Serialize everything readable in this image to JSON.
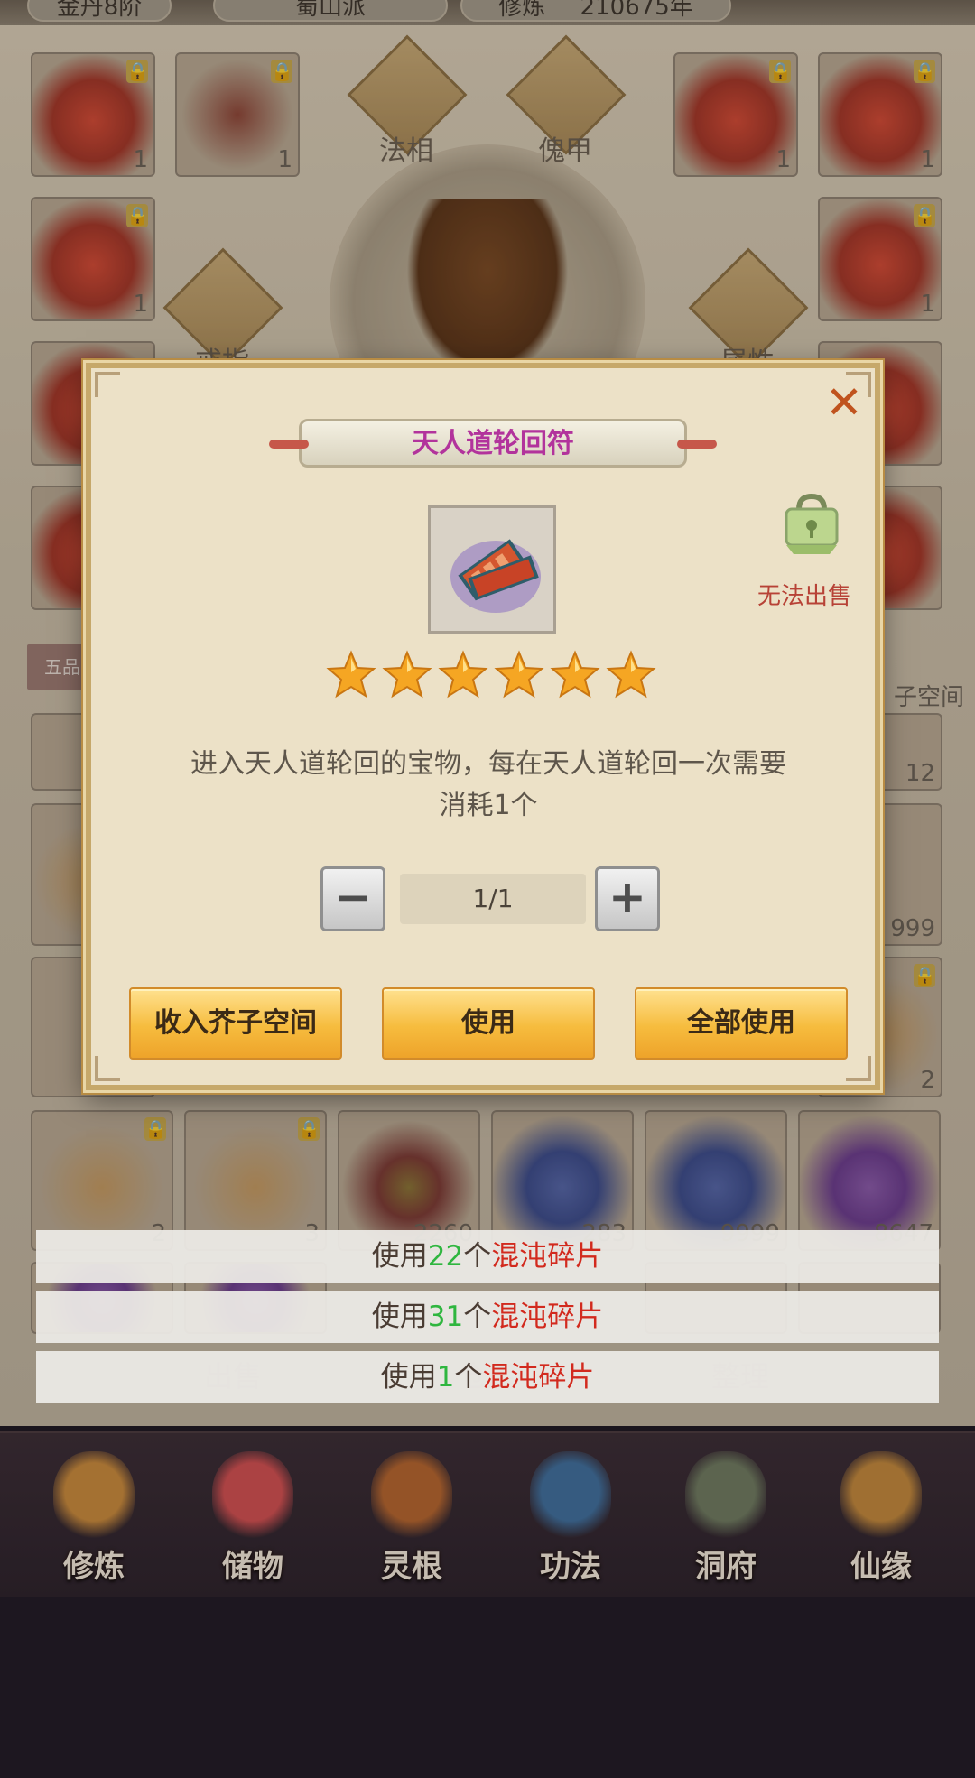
{
  "topbar": {
    "realm_label": "金丹8阶",
    "sect_label": "蜀山派",
    "cultivation_label": "修炼",
    "cultivation_value": "210675年"
  },
  "equipment": {
    "slots_top_left": [
      {
        "count": "1",
        "icon": "fire-armor-icon",
        "locked": true
      },
      {
        "count": "1",
        "icon": "bow-icon",
        "locked": true
      },
      {
        "count": "1",
        "icon": "fire-armor-icon",
        "locked": true
      },
      {
        "count": "1",
        "icon": "fire-armor-icon",
        "locked": true
      },
      {
        "count": "1",
        "icon": "fire-armor-icon",
        "locked": true
      }
    ],
    "faxiang_label": "法相",
    "kuijia_label": "傀甲",
    "ring_label": "戒指",
    "attr_label": "属性",
    "rank_tab": "五品",
    "space_label": "子空间"
  },
  "inventory": {
    "row_counts": [
      "12",
      "999",
      "2"
    ],
    "bottom_row": [
      {
        "count": "2",
        "icon": "scroll-icon",
        "locked": true
      },
      {
        "count": "3",
        "icon": "scroll-icon",
        "locked": true
      },
      {
        "count": "2260",
        "icon": "grape-fruit-icon",
        "locked": false
      },
      {
        "count": "283",
        "icon": "blue-lotus-icon",
        "locked": false
      },
      {
        "count": "9999",
        "icon": "blue-lotus-icon",
        "locked": false
      },
      {
        "count": "8647",
        "icon": "purple-lotus-icon",
        "locked": false
      }
    ]
  },
  "bottom_actions": {
    "sell": "出售",
    "middle": "仓库",
    "organize": "整理"
  },
  "nav": [
    {
      "label": "修炼",
      "icon": "hooded-monk-icon",
      "color": "#c98a3a"
    },
    {
      "label": "储物",
      "icon": "treasure-bag-icon",
      "color": "#d14f4f"
    },
    {
      "label": "灵根",
      "icon": "spirit-root-icon",
      "color": "#b5652c"
    },
    {
      "label": "功法",
      "icon": "technique-book-icon",
      "color": "#3f6f9c"
    },
    {
      "label": "洞府",
      "icon": "cave-gate-icon",
      "color": "#6e7a5e"
    },
    {
      "label": "仙缘",
      "icon": "gourd-icon",
      "color": "#c2883a"
    }
  ],
  "dialog": {
    "title": "天人道轮回符",
    "item_icon": "talisman-scroll-icon",
    "stars": 6,
    "no_sell": "无法出售",
    "description_line1": "进入天人道轮回的宝物，每在天人道轮回一次需要",
    "description_line2": "消耗1个",
    "quantity": "1/1",
    "minus_label": "−",
    "plus_label": "+",
    "btn_store": "收入芥子空间",
    "btn_use": "使用",
    "btn_use_all": "全部使用",
    "close_label": "✕"
  },
  "toasts": [
    {
      "prefix": "使用",
      "count": "22",
      "mid": "个",
      "item": "混沌碎片"
    },
    {
      "prefix": "使用",
      "count": "31",
      "mid": "个",
      "item": "混沌碎片"
    },
    {
      "prefix": "使用",
      "count": "1",
      "mid": "个",
      "item": "混沌碎片"
    }
  ],
  "colors": {
    "title_magenta": "#b2339c",
    "close_orange": "#c0531e",
    "no_sell_red": "#b74236",
    "toast_green": "#2fb63f",
    "toast_red": "#d22a1e",
    "button_gold": "#f6bc3e"
  }
}
